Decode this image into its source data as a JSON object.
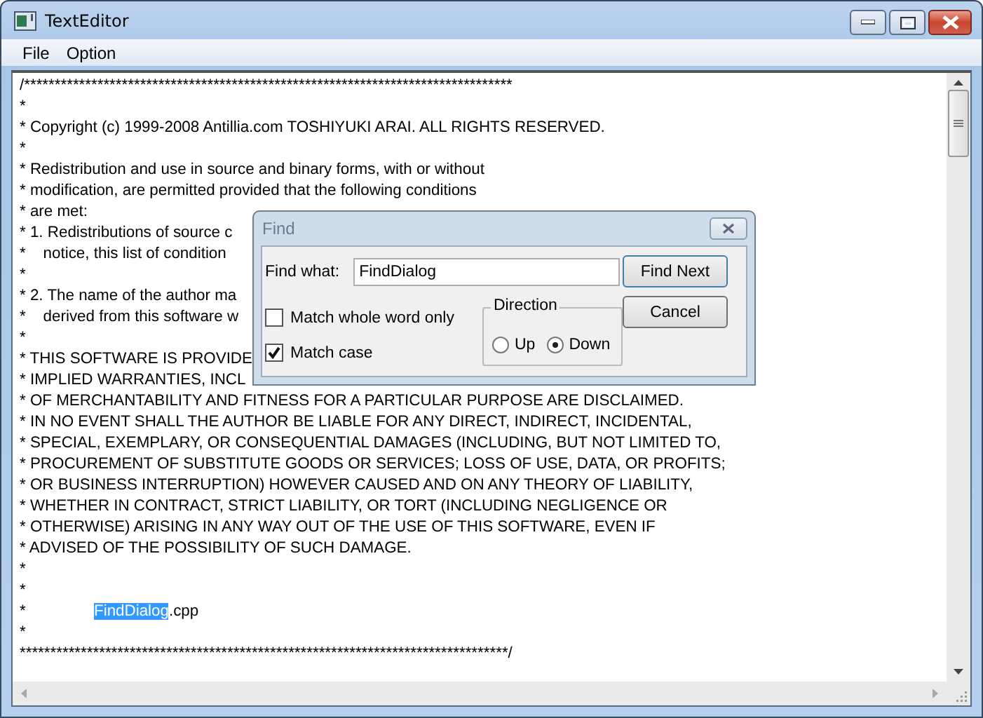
{
  "window": {
    "title": "TextEditor"
  },
  "menu": [
    "File",
    "Option"
  ],
  "editor": {
    "lines": [
      "/********************************************************************************",
      "*",
      "* Copyright (c) 1999-2008 Antillia.com TOSHIYUKI ARAI. ALL RIGHTS RESERVED.",
      "*",
      "* Redistribution and use in source and binary forms, with or without",
      "* modification, are permitted provided that the following conditions",
      "* are met:",
      "* 1. Redistributions of source c",
      "*    notice, this list of condition",
      "*",
      "* 2. The name of the author ma",
      "*    derived from this software w",
      "*",
      "* THIS SOFTWARE IS PROVIDE",
      "* IMPLIED WARRANTIES, INCL",
      "* OF MERCHANTABILITY AND FITNESS FOR A PARTICULAR PURPOSE ARE DISCLAIMED.",
      "* IN NO EVENT SHALL THE AUTHOR BE LIABLE FOR ANY DIRECT, INDIRECT, INCIDENTAL,",
      "* SPECIAL, EXEMPLARY, OR CONSEQUENTIAL DAMAGES (INCLUDING, BUT NOT LIMITED TO,",
      "* PROCUREMENT OF SUBSTITUTE GOODS OR SERVICES; LOSS OF USE, DATA, OR PROFITS;",
      "* OR BUSINESS INTERRUPTION) HOWEVER CAUSED AND ON ANY THEORY OF LIABILITY,",
      "* WHETHER IN CONTRACT, STRICT LIABILITY, OR TORT (INCLUDING NEGLIGENCE OR",
      "* OTHERWISE) ARISING IN ANY WAY OUT OF THE USE OF THIS SOFTWARE, EVEN IF",
      "* ADVISED OF THE POSSIBILITY OF SUCH DAMAGE.",
      "*",
      "*",
      {
        "segments": [
          {
            "text": "*",
            "selected": false
          },
          {
            "text": "FindDialog",
            "selected": true
          },
          {
            "text": ".cpp",
            "selected": false
          }
        ]
      },
      "*",
      "********************************************************************************/"
    ]
  },
  "find_dialog": {
    "title": "Find",
    "find_what_label": "Find what:",
    "find_what_value": "FindDialog",
    "options": [
      {
        "label": "Match whole word only",
        "checked": false
      },
      {
        "label": "Match case",
        "checked": true
      }
    ],
    "direction": {
      "label": "Direction",
      "options": [
        {
          "label": "Up",
          "selected": false
        },
        {
          "label": "Down",
          "selected": true
        }
      ]
    },
    "buttons": [
      "Find Next",
      "Cancel"
    ]
  }
}
